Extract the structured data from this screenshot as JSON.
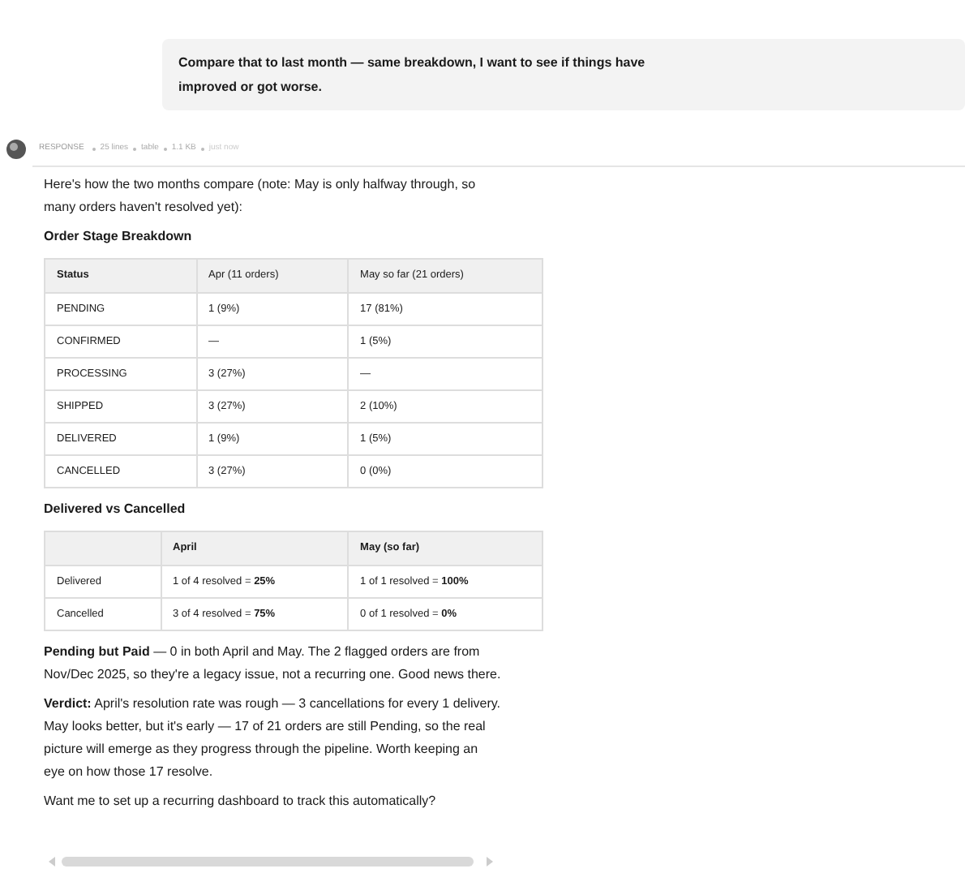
{
  "user_message": "Compare that to last month — same breakdown, I want to see if things have improved or got worse.",
  "response": {
    "label": "RESPONSE",
    "meta": [
      "25 lines",
      "table",
      "1.1 KB",
      "just now"
    ],
    "intro": "Here's how the two months compare (note: May is only halfway through, so many orders haven't resolved yet):",
    "table_1": {
      "title": "Order Stage Breakdown",
      "columns": [
        "Status",
        "Apr (11 orders)",
        "May so far (21 orders)"
      ],
      "rows": [
        [
          "PENDING",
          "1 (9%)",
          "17 (81%)"
        ],
        [
          "CONFIRMED",
          "—",
          "1 (5%)"
        ],
        [
          "PROCESSING",
          "3 (27%)",
          "—"
        ],
        [
          "SHIPPED",
          "3 (27%)",
          "2 (10%)"
        ],
        [
          "DELIVERED",
          "1 (9%)",
          "1 (5%)"
        ],
        [
          "CANCELLED",
          "3 (27%)",
          "0 (0%)"
        ]
      ]
    },
    "table_2": {
      "title": "Delivered vs Cancelled",
      "columns": [
        "",
        "April",
        "May (so far)"
      ],
      "rows": [
        [
          "Delivered",
          "1 of 4 resolved = **25%**",
          "1 of 1 resolved = **100%**"
        ],
        [
          "Cancelled",
          "3 of 4 resolved = **75%**",
          "0 of 1 resolved = **0%**"
        ]
      ]
    },
    "paragraphs": [
      "**Pending but Paid** — 0 in both April and May. The 2 flagged orders are from Nov/Dec 2025, so they're a legacy issue, not a recurring one. Good news there.",
      "**Verdict:** April's resolution rate was rough — 3 cancellations for every 1 delivery. May looks better, but it's early — 17 of 21 orders are still Pending, so the real picture will emerge as they progress through the pipeline. Worth keeping an eye on how those 17 resolve.",
      "Want me to set up a recurring dashboard to track this automatically?"
    ]
  }
}
